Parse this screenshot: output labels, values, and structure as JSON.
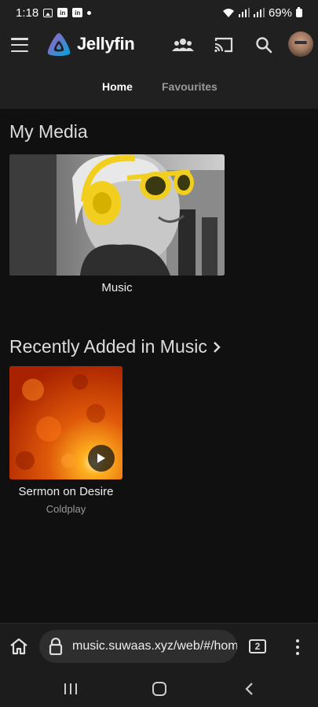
{
  "status_bar": {
    "time": "1:18",
    "battery": "69%"
  },
  "header": {
    "app_name": "Jellyfin",
    "tabs": [
      {
        "label": "Home",
        "active": true
      },
      {
        "label": "Favourites",
        "active": false
      }
    ],
    "icons": [
      "menu-icon",
      "users-icon",
      "cast-icon",
      "search-icon",
      "avatar"
    ]
  },
  "main": {
    "my_media": {
      "title": "My Media",
      "items": [
        {
          "label": "Music"
        }
      ]
    },
    "recently_added": {
      "title": "Recently Added in Music",
      "items": [
        {
          "title": "Sermon on Desire",
          "artist": "Coldplay"
        }
      ]
    }
  },
  "browser": {
    "url": "music.suwaas.xyz/web/#/home",
    "tab_count": "2"
  },
  "colors": {
    "background": "#101010",
    "header": "#202020",
    "brand_purple": "#aa5cc3",
    "brand_blue": "#00a4dc"
  }
}
